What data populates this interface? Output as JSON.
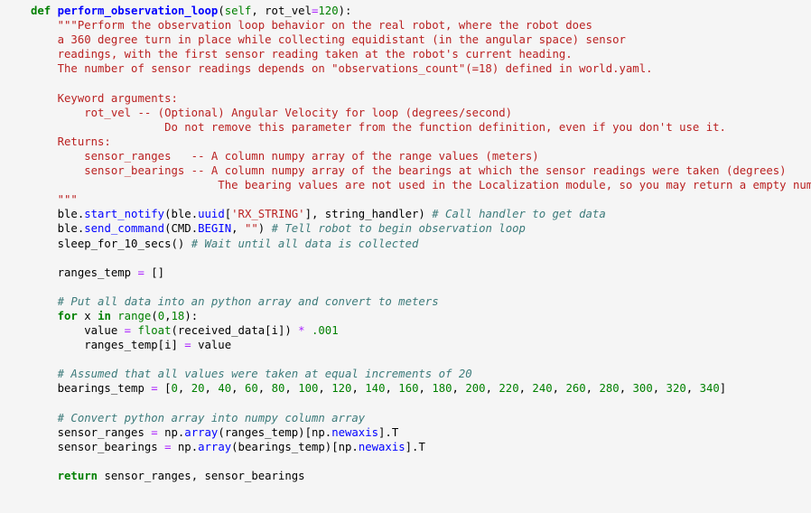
{
  "editor": {
    "kind": "jupyter-code-cell",
    "language": "python",
    "background_color": "#f5f5f5",
    "default_text_color": "#000000",
    "colors": {
      "keyword": "#008000",
      "function_name": "#0000FF",
      "builtin": "#008000",
      "string": "#BA2121",
      "docstring": "#BA2121",
      "comment": "#3D7B7B",
      "number": "#008000",
      "operator": "#AA22FF",
      "attribute": "#0000FF",
      "punctuation": "#000000"
    }
  },
  "code": {
    "lines": [
      {
        "n": 1,
        "text": "def perform_observation_loop(self, rot_vel=120):",
        "tokens": [
          {
            "t": "def",
            "c": "k"
          },
          {
            "t": " ",
            "c": "n"
          },
          {
            "t": "perform_observation_loop",
            "c": "nf"
          },
          {
            "t": "(",
            "c": "p"
          },
          {
            "t": "self",
            "c": "bp"
          },
          {
            "t": ", rot_vel",
            "c": "n"
          },
          {
            "t": "=",
            "c": "op"
          },
          {
            "t": "120",
            "c": "mi"
          },
          {
            "t": "):",
            "c": "p"
          }
        ]
      },
      {
        "n": 2,
        "text": "    \"\"\"Perform the observation loop behavior on the real robot, where the robot does",
        "tokens": [
          {
            "t": "    \"\"\"Perform the observation loop behavior on the real robot, where the robot does",
            "c": "sd"
          }
        ]
      },
      {
        "n": 3,
        "text": "    a 360 degree turn in place while collecting equidistant (in the angular space) sensor",
        "tokens": [
          {
            "t": "    a 360 degree turn in place while collecting equidistant (in the angular space) sensor",
            "c": "sd"
          }
        ]
      },
      {
        "n": 4,
        "text": "    readings, with the first sensor reading taken at the robot's current heading.",
        "tokens": [
          {
            "t": "    readings, with the first sensor reading taken at the robot's current heading.",
            "c": "sd"
          }
        ]
      },
      {
        "n": 5,
        "text": "    The number of sensor readings depends on \"observations_count\"(=18) defined in world.yaml.",
        "tokens": [
          {
            "t": "    The number of sensor readings depends on \"observations_count\"(=18) defined in world.yaml.",
            "c": "sd"
          }
        ]
      },
      {
        "n": 6,
        "text": "",
        "tokens": [
          {
            "t": "",
            "c": "sd"
          }
        ]
      },
      {
        "n": 7,
        "text": "    Keyword arguments:",
        "tokens": [
          {
            "t": "    Keyword arguments:",
            "c": "sd"
          }
        ]
      },
      {
        "n": 8,
        "text": "        rot_vel -- (Optional) Angular Velocity for loop (degrees/second)",
        "tokens": [
          {
            "t": "        rot_vel -- (Optional) Angular Velocity for loop (degrees/second)",
            "c": "sd"
          }
        ]
      },
      {
        "n": 9,
        "text": "                    Do not remove this parameter from the function definition, even if you don't use it.",
        "tokens": [
          {
            "t": "                    Do not remove this parameter from the function definition, even if you don't use it.",
            "c": "sd"
          }
        ]
      },
      {
        "n": 10,
        "text": "    Returns:",
        "tokens": [
          {
            "t": "    Returns:",
            "c": "sd"
          }
        ]
      },
      {
        "n": 11,
        "text": "        sensor_ranges   -- A column numpy array of the range values (meters)",
        "tokens": [
          {
            "t": "        sensor_ranges   -- A column numpy array of the range values (meters)",
            "c": "sd"
          }
        ]
      },
      {
        "n": 12,
        "text": "        sensor_bearings -- A column numpy array of the bearings at which the sensor readings were taken (degrees)",
        "tokens": [
          {
            "t": "        sensor_bearings -- A column numpy array of the bearings at which the sensor readings were taken (degrees)",
            "c": "sd"
          }
        ]
      },
      {
        "n": 13,
        "text": "                            The bearing values are not used in the Localization module, so you may return a empty numpy array",
        "tokens": [
          {
            "t": "                            The bearing values are not used in the Localization module, so you may return a empty numpy array",
            "c": "sd"
          }
        ]
      },
      {
        "n": 14,
        "text": "    \"\"\"",
        "tokens": [
          {
            "t": "    \"\"\"",
            "c": "sd"
          }
        ]
      },
      {
        "n": 15,
        "text": "    ble.start_notify(ble.uuid['RX_STRING'], string_handler) # Call handler to get data",
        "tokens": [
          {
            "t": "    ble.",
            "c": "n"
          },
          {
            "t": "start_notify",
            "c": "na"
          },
          {
            "t": "(ble.",
            "c": "n"
          },
          {
            "t": "uuid",
            "c": "na"
          },
          {
            "t": "[",
            "c": "p"
          },
          {
            "t": "'RX_STRING'",
            "c": "s"
          },
          {
            "t": "], string_handler) ",
            "c": "n"
          },
          {
            "t": "# Call handler to get data",
            "c": "c1"
          }
        ]
      },
      {
        "n": 16,
        "text": "    ble.send_command(CMD.BEGIN, \"\") # Tell robot to begin observation loop",
        "tokens": [
          {
            "t": "    ble.",
            "c": "n"
          },
          {
            "t": "send_command",
            "c": "na"
          },
          {
            "t": "(CMD.",
            "c": "n"
          },
          {
            "t": "BEGIN",
            "c": "na"
          },
          {
            "t": ", ",
            "c": "n"
          },
          {
            "t": "\"\"",
            "c": "s"
          },
          {
            "t": ") ",
            "c": "n"
          },
          {
            "t": "# Tell robot to begin observation loop",
            "c": "c1"
          }
        ]
      },
      {
        "n": 17,
        "text": "    sleep_for_10_secs() # Wait until all data is collected",
        "tokens": [
          {
            "t": "    sleep_for_10_secs() ",
            "c": "n"
          },
          {
            "t": "# Wait until all data is collected",
            "c": "c1"
          }
        ]
      },
      {
        "n": 18,
        "text": "",
        "tokens": []
      },
      {
        "n": 19,
        "text": "    ranges_temp = []",
        "tokens": [
          {
            "t": "    ranges_temp ",
            "c": "n"
          },
          {
            "t": "=",
            "c": "op"
          },
          {
            "t": " []",
            "c": "p"
          }
        ]
      },
      {
        "n": 20,
        "text": "",
        "tokens": []
      },
      {
        "n": 21,
        "text": "    # Put all data into an python array and convert to meters",
        "tokens": [
          {
            "t": "    # Put all data into an python array and convert to meters",
            "c": "c1"
          }
        ]
      },
      {
        "n": 22,
        "text": "    for x in range(0,18):",
        "tokens": [
          {
            "t": "    ",
            "c": "n"
          },
          {
            "t": "for",
            "c": "k"
          },
          {
            "t": " x ",
            "c": "n"
          },
          {
            "t": "in",
            "c": "k"
          },
          {
            "t": " ",
            "c": "n"
          },
          {
            "t": "range",
            "c": "nb"
          },
          {
            "t": "(",
            "c": "p"
          },
          {
            "t": "0",
            "c": "mi"
          },
          {
            "t": ",",
            "c": "p"
          },
          {
            "t": "18",
            "c": "mi"
          },
          {
            "t": "):",
            "c": "p"
          }
        ]
      },
      {
        "n": 23,
        "text": "        value = float(received_data[i]) * .001",
        "tokens": [
          {
            "t": "        value ",
            "c": "n"
          },
          {
            "t": "=",
            "c": "op"
          },
          {
            "t": " ",
            "c": "n"
          },
          {
            "t": "float",
            "c": "nb"
          },
          {
            "t": "(received_data[i]) ",
            "c": "n"
          },
          {
            "t": "*",
            "c": "op"
          },
          {
            "t": " ",
            "c": "n"
          },
          {
            "t": ".001",
            "c": "mi"
          }
        ]
      },
      {
        "n": 24,
        "text": "        ranges_temp[i] = value",
        "tokens": [
          {
            "t": "        ranges_temp[i] ",
            "c": "n"
          },
          {
            "t": "=",
            "c": "op"
          },
          {
            "t": " value",
            "c": "n"
          }
        ]
      },
      {
        "n": 25,
        "text": "",
        "tokens": []
      },
      {
        "n": 26,
        "text": "    # Assumed that all values were taken at equal increments of 20",
        "tokens": [
          {
            "t": "    # Assumed that all values were taken at equal increments of 20",
            "c": "c1"
          }
        ]
      },
      {
        "n": 27,
        "text": "    bearings_temp = [0, 20, 40, 60, 80, 100, 120, 140, 160, 180, 200, 220, 240, 260, 280, 300, 320, 340]",
        "tokens": [
          {
            "t": "    bearings_temp ",
            "c": "n"
          },
          {
            "t": "=",
            "c": "op"
          },
          {
            "t": " [",
            "c": "p"
          },
          {
            "t": "0",
            "c": "mi"
          },
          {
            "t": ", ",
            "c": "p"
          },
          {
            "t": "20",
            "c": "mi"
          },
          {
            "t": ", ",
            "c": "p"
          },
          {
            "t": "40",
            "c": "mi"
          },
          {
            "t": ", ",
            "c": "p"
          },
          {
            "t": "60",
            "c": "mi"
          },
          {
            "t": ", ",
            "c": "p"
          },
          {
            "t": "80",
            "c": "mi"
          },
          {
            "t": ", ",
            "c": "p"
          },
          {
            "t": "100",
            "c": "mi"
          },
          {
            "t": ", ",
            "c": "p"
          },
          {
            "t": "120",
            "c": "mi"
          },
          {
            "t": ", ",
            "c": "p"
          },
          {
            "t": "140",
            "c": "mi"
          },
          {
            "t": ", ",
            "c": "p"
          },
          {
            "t": "160",
            "c": "mi"
          },
          {
            "t": ", ",
            "c": "p"
          },
          {
            "t": "180",
            "c": "mi"
          },
          {
            "t": ", ",
            "c": "p"
          },
          {
            "t": "200",
            "c": "mi"
          },
          {
            "t": ", ",
            "c": "p"
          },
          {
            "t": "220",
            "c": "mi"
          },
          {
            "t": ", ",
            "c": "p"
          },
          {
            "t": "240",
            "c": "mi"
          },
          {
            "t": ", ",
            "c": "p"
          },
          {
            "t": "260",
            "c": "mi"
          },
          {
            "t": ", ",
            "c": "p"
          },
          {
            "t": "280",
            "c": "mi"
          },
          {
            "t": ", ",
            "c": "p"
          },
          {
            "t": "300",
            "c": "mi"
          },
          {
            "t": ", ",
            "c": "p"
          },
          {
            "t": "320",
            "c": "mi"
          },
          {
            "t": ", ",
            "c": "p"
          },
          {
            "t": "340",
            "c": "mi"
          },
          {
            "t": "]",
            "c": "p"
          }
        ]
      },
      {
        "n": 28,
        "text": "",
        "tokens": []
      },
      {
        "n": 29,
        "text": "    # Convert python array into numpy column array",
        "tokens": [
          {
            "t": "    # Convert python array into numpy column array",
            "c": "c1"
          }
        ]
      },
      {
        "n": 30,
        "text": "    sensor_ranges = np.array(ranges_temp)[np.newaxis].T",
        "tokens": [
          {
            "t": "    sensor_ranges ",
            "c": "n"
          },
          {
            "t": "=",
            "c": "op"
          },
          {
            "t": " np.",
            "c": "n"
          },
          {
            "t": "array",
            "c": "na"
          },
          {
            "t": "(ranges_temp)[np.",
            "c": "n"
          },
          {
            "t": "newaxis",
            "c": "na"
          },
          {
            "t": "].T",
            "c": "n"
          }
        ]
      },
      {
        "n": 31,
        "text": "    sensor_bearings = np.array(bearings_temp)[np.newaxis].T",
        "tokens": [
          {
            "t": "    sensor_bearings ",
            "c": "n"
          },
          {
            "t": "=",
            "c": "op"
          },
          {
            "t": " np.",
            "c": "n"
          },
          {
            "t": "array",
            "c": "na"
          },
          {
            "t": "(bearings_temp)[np.",
            "c": "n"
          },
          {
            "t": "newaxis",
            "c": "na"
          },
          {
            "t": "].T",
            "c": "n"
          }
        ]
      },
      {
        "n": 32,
        "text": "",
        "tokens": []
      },
      {
        "n": 33,
        "text": "    return sensor_ranges, sensor_bearings",
        "tokens": [
          {
            "t": "    ",
            "c": "n"
          },
          {
            "t": "return",
            "c": "k"
          },
          {
            "t": " sensor_ranges, sensor_bearings",
            "c": "n"
          }
        ]
      }
    ]
  }
}
